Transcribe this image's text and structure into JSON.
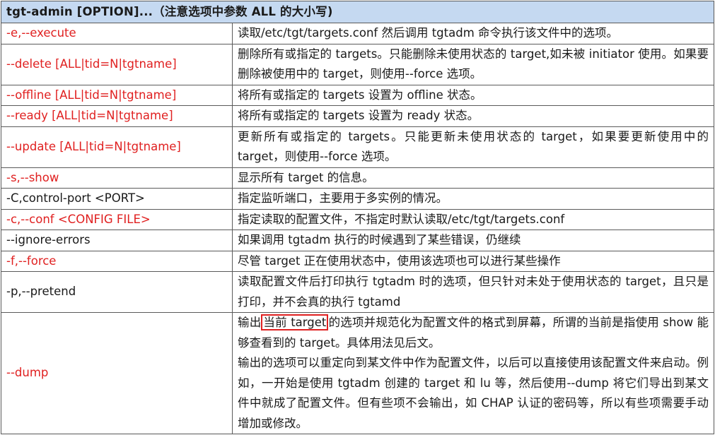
{
  "header": "tgt-admin [OPTION]...（注意选项中参数 ALL 的大小写)",
  "rows": [
    {
      "option": "-e,--execute",
      "desc": "读取/etc/tgt/targets.conf 然后调用 tgtadm 命令执行该文件中的选项。"
    },
    {
      "option": "--delete [ALL|tid=N|tgtname]",
      "desc": "删除所有或指定的 targets。只能删除未使用状态的 target,如未被 initiator 使用。如果要删除被使用中的 target，则使用--force 选项。"
    },
    {
      "option": "--offline [ALL|tid=N|tgtname]",
      "desc": "将所有或指定的 targets 设置为 offline 状态。"
    },
    {
      "option": "--ready [ALL|tid=N|tgtname]",
      "desc": "将所有或指定的 targets 设置为 ready 状态。"
    },
    {
      "option": "--update [ALL|tid=N|tgtname]",
      "desc": "更新所有或指定的 targets。只能更新未使用状态的 target，如果要更新使用中的 target，则使用--force 选项。"
    },
    {
      "option": "-s,--show",
      "desc": "显示所有 target 的信息。"
    },
    {
      "option": "-C,control-port <PORT>",
      "desc": "指定监听端口，主要用于多实例的情况。"
    },
    {
      "option": "-c,--conf <CONFIG FILE>",
      "desc": "指定读取的配置文件，不指定时默认读取/etc/tgt/targets.conf"
    },
    {
      "option": "--ignore-errors",
      "desc": "如果调用 tgtadm 执行的时候遇到了某些错误，仍继续"
    },
    {
      "option": "-f,--force",
      "desc": "尽管 target 正在使用状态中，使用该选项也可以进行某些操作"
    },
    {
      "option": "-p,--pretend",
      "desc": "读取配置文件后打印执行  tgtadm 时的选项，但只针对未处于使用状态的 target，且只是打印，并不会真的执行 tgtamd"
    },
    {
      "option": "--dump",
      "desc_p1_before": "输出",
      "desc_p1_highlight": "当前 target",
      "desc_p1_after": "的选项并规范化为配置文件的格式到屏幕，所谓的当前是指使用 show 能够查看到的 target。具体用法见后文。",
      "desc_p2": "输出的选项可以重定向到某文件中作为配置文件，以后可以直接使用该配置文件来启动。例如，一开始是使用 tgtadm 创建的 target 和 lu 等，然后使用--dump 将它们导出到某文件中就成了配置文件。但有些项不会输出，如 CHAP 认证的密码等，所以有些项需要手动增加或修改。"
    }
  ],
  "colors": {
    "header_bg": "#c5d9f1",
    "option_red": "#e02020",
    "highlight_box": "#e02020",
    "border": "#5a5a5a"
  }
}
